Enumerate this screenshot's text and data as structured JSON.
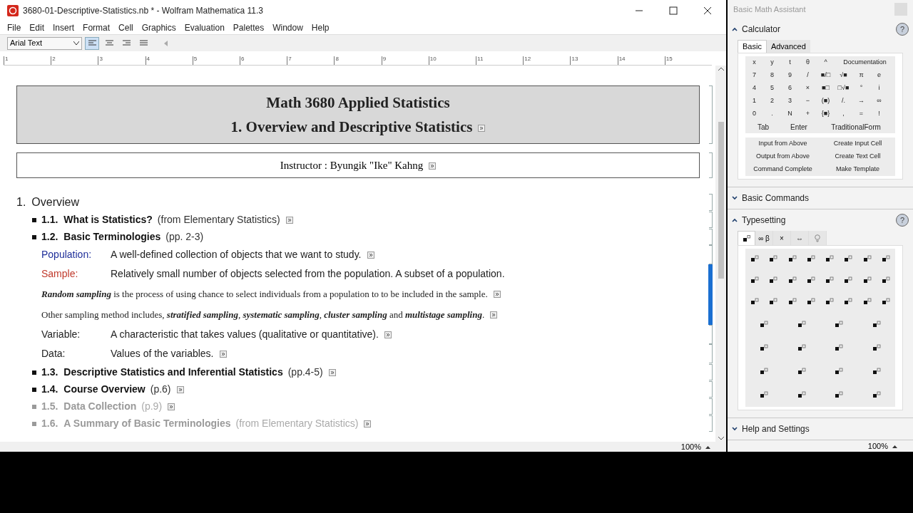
{
  "window": {
    "title": "3680-01-Descriptive-Statistics.nb * - Wolfram Mathematica 11.3"
  },
  "menu": [
    "File",
    "Edit",
    "Insert",
    "Format",
    "Cell",
    "Graphics",
    "Evaluation",
    "Palettes",
    "Window",
    "Help"
  ],
  "toolbar": {
    "style_select": "Arial Text",
    "alignments": [
      {
        "selected": true
      },
      {
        "selected": false
      },
      {
        "selected": false
      },
      {
        "selected": false
      }
    ]
  },
  "ruler": [
    "1",
    "2",
    "3",
    "4",
    "5",
    "6",
    "7",
    "8",
    "9",
    "10",
    "11",
    "12",
    "13",
    "14",
    "15"
  ],
  "cells": [
    {
      "kind": "title",
      "lines": [
        "Math 3680 Applied Statistics",
        "1.  Overview and Descriptive Statistics"
      ],
      "selected": false
    },
    {
      "kind": "instructor",
      "text": "Instructor :  Byungik \"Ike\" Kahng",
      "selected": false
    },
    {
      "kind": "section",
      "number": "1.",
      "title": "Overview",
      "selected": false
    },
    {
      "kind": "subsection",
      "number": "1.1.",
      "title": "What is Statistics?",
      "note": "(from Elementary Statistics)",
      "dimmed": false,
      "link": true,
      "selected": false
    },
    {
      "kind": "subsection",
      "number": "1.2.",
      "title": "Basic Terminologies",
      "note": "(pp. 2-3)",
      "dimmed": false,
      "link": false,
      "selected": false
    },
    {
      "kind": "definition",
      "term": "Population:",
      "text": "A well-defined collection of objects that we want to study.",
      "color": "#1f2f9a",
      "link": true,
      "selected": false
    },
    {
      "kind": "definition",
      "term": "Sample:",
      "text": "Relatively small number of objects selected from the population.  A subset of a population.",
      "color": "#c0392b",
      "link": false,
      "selected": true
    },
    {
      "kind": "paragraph",
      "text": "**Random sampling** is the process of using chance to select individuals from a population to to be included in the sample.",
      "selected": true
    },
    {
      "kind": "paragraph",
      "text": "Other sampling method includes, **stratified sampling**, **systematic sampling**, **cluster sampling** and **multistage sampling**.",
      "selected": true
    },
    {
      "kind": "definition",
      "term": "Variable:",
      "text": "A characteristic that takes values (qualitative or quantitative).",
      "color": "#222222",
      "link": true,
      "selected": false
    },
    {
      "kind": "definition",
      "term": "Data:",
      "text": "Values of the variables.",
      "color": "#222222",
      "link": true,
      "selected": false
    },
    {
      "kind": "subsection",
      "number": "1.3.",
      "title": "Descriptive Statistics and Inferential Statistics",
      "note": "(pp.4-5)",
      "dimmed": false,
      "link": true,
      "selected": false
    },
    {
      "kind": "subsection",
      "number": "1.4.",
      "title": "Course Overview",
      "note": "(p.6)",
      "dimmed": false,
      "link": true,
      "selected": false
    },
    {
      "kind": "subsection",
      "number": "1.5.",
      "title": "Data Collection",
      "note": "(p.9)",
      "dimmed": true,
      "link": true,
      "selected": false
    },
    {
      "kind": "subsection",
      "number": "1.6.",
      "title": "A Summary of Basic Terminologies",
      "note": "(from Elementary Statistics)",
      "dimmed": true,
      "link": true,
      "selected": false
    }
  ],
  "zoom": "100%",
  "palette": {
    "title": "Basic Math Assistant",
    "calculator": {
      "title": "Calculator",
      "expanded": true,
      "help_button": "?",
      "tabs": [
        {
          "label": "Basic",
          "selected": true
        },
        {
          "label": "Advanced",
          "selected": false
        }
      ],
      "keys": [
        [
          "x",
          "y",
          "t",
          "θ",
          "^"
        ],
        [
          "7",
          "8",
          "9",
          "/",
          "■/□",
          "√■",
          "π",
          "e"
        ],
        [
          "4",
          "5",
          "6",
          "×",
          "■□",
          "□√■",
          "°",
          "i"
        ],
        [
          "1",
          "2",
          "3",
          "−",
          "(■)",
          "/.",
          "→",
          "∞"
        ],
        [
          "0",
          ".",
          "N",
          "+",
          "{■}",
          ",",
          "=",
          "!"
        ]
      ],
      "documentation": "Documentation",
      "wide_keys": [
        "Tab",
        "Enter",
        "TraditionalForm"
      ],
      "actions": [
        "Input from Above",
        "Create Input Cell",
        "Output from Above",
        "Create Text Cell",
        "Command Complete",
        "Make Template"
      ]
    },
    "basic_commands": {
      "title": "Basic Commands",
      "expanded": false
    },
    "typesetting": {
      "title": "Typesetting",
      "expanded": true,
      "help_button": "?",
      "tabs": [
        {
          "kind": "icon",
          "selected": true
        },
        {
          "kind": "text",
          "label": "∞ β",
          "selected": false
        },
        {
          "kind": "text",
          "label": "×",
          "selected": false
        },
        {
          "kind": "text",
          "label": "⇔",
          "selected": false
        },
        {
          "kind": "bulb",
          "selected": false
        }
      ]
    },
    "help": {
      "title": "Help and Settings",
      "expanded": false
    },
    "zoom": "100%"
  }
}
